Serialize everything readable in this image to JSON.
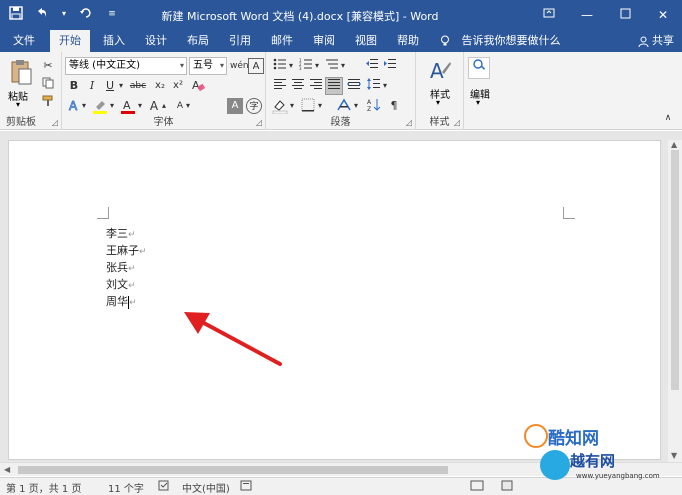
{
  "title_bar": {
    "title": "新建 Microsoft Word 文档 (4).docx [兼容模式] - Word",
    "qat": {
      "save": "save-icon",
      "undo": "undo-icon",
      "redo": "redo-icon",
      "customize": "customize-icon"
    },
    "buttons": {
      "ribbon_options": "ribbon-display-icon",
      "minimize": "minimize-icon",
      "maximize": "maximize-icon",
      "close": "close-icon"
    }
  },
  "menu": {
    "tabs": [
      "文件",
      "开始",
      "插入",
      "设计",
      "布局",
      "引用",
      "邮件",
      "审阅",
      "视图",
      "帮助"
    ],
    "active_tab": "开始",
    "tell_me": "告诉我你想要做什么",
    "share": "共享"
  },
  "ribbon": {
    "clipboard": {
      "paste_label": "粘贴",
      "group_label": "剪贴板"
    },
    "font": {
      "font_name": "等线 (中文正文)",
      "font_size": "五号",
      "group_label": "字体"
    },
    "paragraph": {
      "group_label": "段落"
    },
    "styles": {
      "styles_label": "样式",
      "group_label": "样式"
    },
    "editing": {
      "editing_label": "编辑"
    }
  },
  "document": {
    "lines": [
      "李三",
      "王麻子",
      "张兵",
      "刘文",
      "周华"
    ],
    "paragraph_mark": "↵"
  },
  "status_bar": {
    "page": "第 1 页，共 1 页",
    "words": "11 个字",
    "language": "中文(中国)"
  },
  "watermark": {
    "brand1": "酷知网",
    "brand2": "越有网",
    "url": "www.yueyangbang.com"
  },
  "colors": {
    "word_blue": "#2b579a",
    "arrow_red": "#e02020",
    "highlight": "#ffff00",
    "font_color": "#e00000"
  }
}
